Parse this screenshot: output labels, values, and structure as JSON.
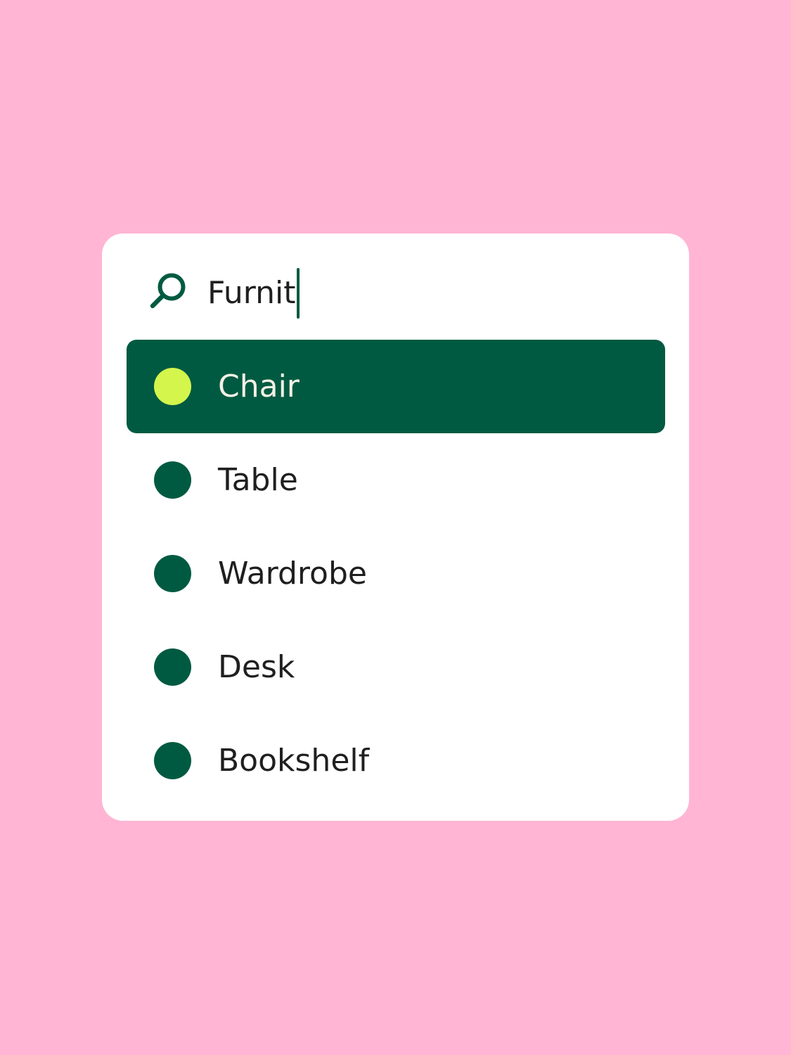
{
  "colors": {
    "background": "#FFB5D3",
    "card": "#FFFFFF",
    "accent_green": "#005A41",
    "highlight_dot": "#D4F54C",
    "selected_text": "#F3F0E6",
    "text": "#1F1F1F"
  },
  "search": {
    "icon": "search-icon",
    "value": "Furnit"
  },
  "results": {
    "selected_index": 0,
    "items": [
      {
        "label": "Chair"
      },
      {
        "label": "Table"
      },
      {
        "label": "Wardrobe"
      },
      {
        "label": "Desk"
      },
      {
        "label": "Bookshelf"
      }
    ]
  }
}
